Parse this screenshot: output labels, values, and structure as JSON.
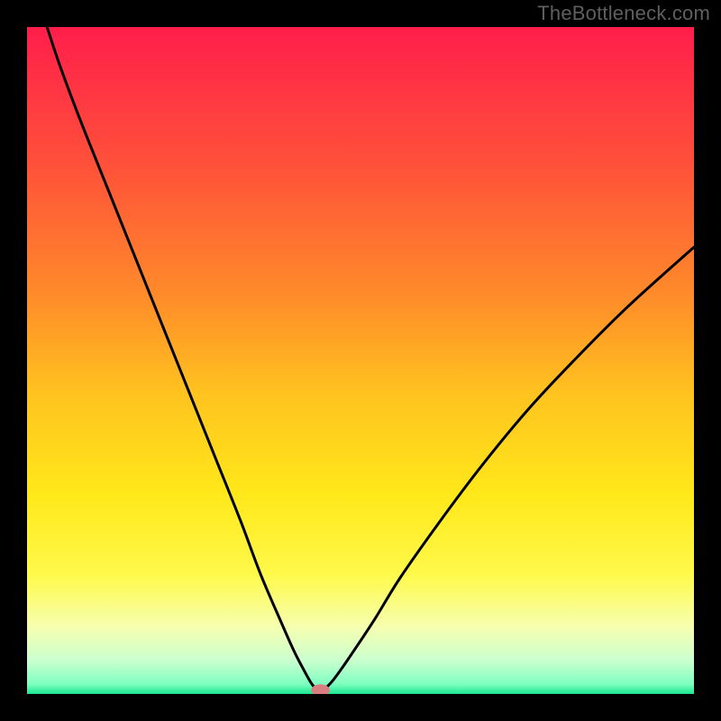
{
  "watermark": "TheBottleneck.com",
  "chart_data": {
    "type": "line",
    "title": "",
    "xlabel": "",
    "ylabel": "",
    "xlim": [
      0,
      100
    ],
    "ylim": [
      0,
      100
    ],
    "grid": false,
    "legend": false,
    "background_gradient": {
      "stops": [
        {
          "pos": 0.0,
          "color": "#ff1e4b"
        },
        {
          "pos": 0.2,
          "color": "#ff4f3a"
        },
        {
          "pos": 0.4,
          "color": "#ff8a2a"
        },
        {
          "pos": 0.55,
          "color": "#ffc31f"
        },
        {
          "pos": 0.7,
          "color": "#ffe81a"
        },
        {
          "pos": 0.82,
          "color": "#fff94a"
        },
        {
          "pos": 0.9,
          "color": "#f6ffb0"
        },
        {
          "pos": 0.95,
          "color": "#caffcf"
        },
        {
          "pos": 0.985,
          "color": "#7fffc0"
        },
        {
          "pos": 1.0,
          "color": "#18e890"
        }
      ]
    },
    "series": [
      {
        "name": "bottleneck-curve",
        "color": "#000000",
        "x": [
          3,
          5,
          8,
          12,
          16,
          20,
          24,
          28,
          32,
          35,
          38,
          40,
          41.5,
          42.5,
          43.2,
          43.8,
          44.2,
          44.8,
          46,
          48,
          52,
          56,
          62,
          68,
          75,
          82,
          90,
          100
        ],
        "y": [
          100,
          94,
          86,
          76,
          66,
          56,
          46,
          36,
          26,
          18,
          11,
          6.5,
          3.6,
          1.8,
          0.9,
          0.55,
          0.55,
          0.9,
          2.2,
          5,
          11,
          17.5,
          26,
          34,
          42.5,
          50,
          58,
          67
        ]
      }
    ],
    "marker": {
      "name": "optimal-point",
      "x": 44.0,
      "y": 0.55,
      "color": "#d97f82",
      "rx": 1.4,
      "ry": 0.9
    }
  }
}
